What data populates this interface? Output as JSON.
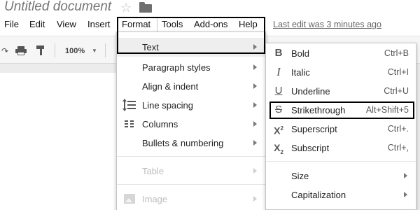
{
  "document": {
    "title": "Untitled document",
    "star_icon": "star-icon",
    "folder_icon": "folder-icon"
  },
  "menubar": {
    "items": [
      "File",
      "Edit",
      "View",
      "Insert",
      "Format",
      "Tools",
      "Add-ons",
      "Help"
    ],
    "active_item": "Format",
    "last_edit": "Last edit was 3 minutes ago"
  },
  "toolbar": {
    "zoom": "100%",
    "icons": [
      "redo-icon",
      "print-icon",
      "paint-format-icon"
    ]
  },
  "format_menu": {
    "items": [
      {
        "label": "Text",
        "submenu": true,
        "highlighted": true
      },
      {
        "label": "Paragraph styles",
        "submenu": true
      },
      {
        "label": "Align & indent",
        "submenu": true
      },
      {
        "label": "Line spacing",
        "submenu": true,
        "icon": "line-spacing-icon"
      },
      {
        "label": "Columns",
        "submenu": true,
        "icon": "columns-icon"
      },
      {
        "label": "Bullets & numbering",
        "submenu": true
      },
      {
        "label": "Table",
        "submenu": true,
        "disabled": true
      },
      {
        "label": "Image",
        "submenu": true,
        "disabled": true,
        "icon": "image-icon"
      }
    ]
  },
  "text_submenu": {
    "items": [
      {
        "label": "Bold",
        "shortcut": "Ctrl+B",
        "icon": "bold-icon"
      },
      {
        "label": "Italic",
        "shortcut": "Ctrl+I",
        "icon": "italic-icon"
      },
      {
        "label": "Underline",
        "shortcut": "Ctrl+U",
        "icon": "underline-icon"
      },
      {
        "label": "Strikethrough",
        "shortcut": "Alt+Shift+5",
        "icon": "strikethrough-icon",
        "highlighted": true
      },
      {
        "label": "Superscript",
        "shortcut": "Ctrl+.",
        "icon": "superscript-icon"
      },
      {
        "label": "Subscript",
        "shortcut": "Ctrl+,",
        "icon": "subscript-icon"
      },
      {
        "label": "Size",
        "submenu": true
      },
      {
        "label": "Capitalization",
        "submenu": true
      }
    ]
  },
  "colors": {
    "title_gray": "#757575",
    "toolbar_bg": "#f6f6f6",
    "canvas_bg": "#ececec",
    "highlight_border": "#000000",
    "disabled_text": "#bdbdbd"
  }
}
